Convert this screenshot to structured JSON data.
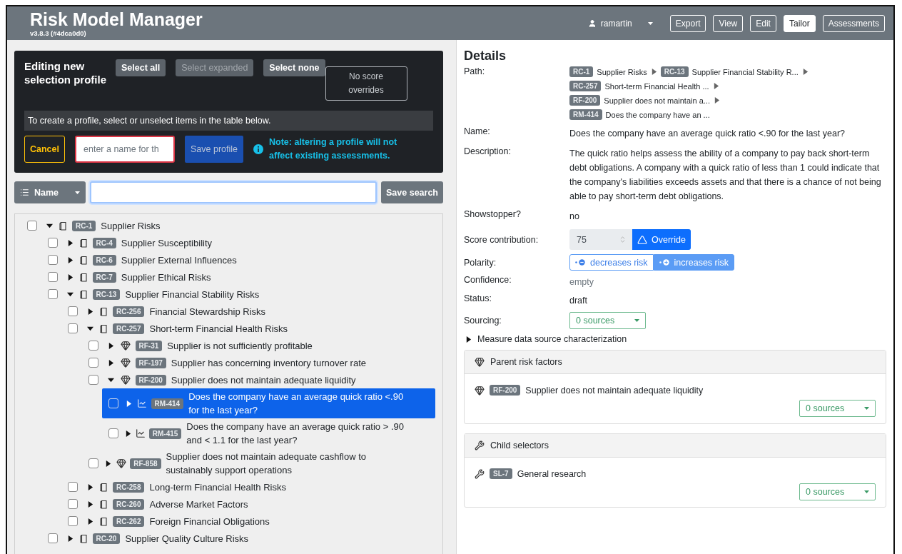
{
  "header": {
    "title": "Risk Model Manager",
    "version": "v3.8.3 (#4dca0d0)",
    "user": "ramartin",
    "nav": [
      {
        "label": "Export",
        "selected": false
      },
      {
        "label": "View",
        "selected": false
      },
      {
        "label": "Edit",
        "selected": false
      },
      {
        "label": "Tailor",
        "selected": true
      },
      {
        "label": "Assessments",
        "selected": false
      }
    ]
  },
  "profile_editor": {
    "title": "Editing new selection profile",
    "select_buttons": [
      {
        "label": "Select all",
        "disabled": false
      },
      {
        "label": "Select expanded",
        "disabled": true
      },
      {
        "label": "Select none",
        "disabled": false
      }
    ],
    "overrides_button": "No score overrides",
    "hint": "To create a profile, select or unselect items in the table below.",
    "cancel_button": "Cancel",
    "name_field": {
      "placeholder": "enter a name for th"
    },
    "save_button": "Save profile",
    "note": "Note: altering a profile will not affect existing assessments."
  },
  "search": {
    "field_button": "Name",
    "save_button": "Save search"
  },
  "tree": [
    {
      "kind": "category",
      "code": "RC-1",
      "label": "Supplier Risks",
      "checked": false,
      "expanded": true,
      "selected": false,
      "children": [
        {
          "kind": "category",
          "code": "RC-4",
          "label": "Supplier Susceptibility",
          "checked": false,
          "expanded": false,
          "selected": false
        },
        {
          "kind": "category",
          "code": "RC-6",
          "label": "Supplier External Influences",
          "checked": false,
          "expanded": false,
          "selected": false
        },
        {
          "kind": "category",
          "code": "RC-7",
          "label": "Supplier Ethical Risks",
          "checked": false,
          "expanded": false,
          "selected": false
        },
        {
          "kind": "category",
          "code": "RC-13",
          "label": "Supplier Financial Stability Risks",
          "checked": false,
          "expanded": true,
          "selected": false,
          "children": [
            {
              "kind": "category",
              "code": "RC-256",
              "label": "Financial Stewardship Risks",
              "checked": false,
              "expanded": false,
              "selected": false
            },
            {
              "kind": "category",
              "code": "RC-257",
              "label": "Short-term Financial Health Risks",
              "checked": false,
              "expanded": true,
              "selected": false,
              "children": [
                {
                  "kind": "factor",
                  "code": "RF-31",
                  "label": "Supplier is not sufficiently profitable",
                  "checked": false,
                  "expanded": false,
                  "selected": false
                },
                {
                  "kind": "factor",
                  "code": "RF-197",
                  "label": "Supplier has concerning inventory turnover rate",
                  "checked": false,
                  "expanded": false,
                  "selected": false
                },
                {
                  "kind": "factor",
                  "code": "RF-200",
                  "label": "Supplier does not maintain adequate liquidity",
                  "checked": false,
                  "expanded": true,
                  "selected": false,
                  "children": [
                    {
                      "kind": "measure",
                      "code": "RM-414",
                      "label": "Does the company have an average quick ratio <.90 for the last year?",
                      "checked": false,
                      "expanded": false,
                      "selected": true
                    },
                    {
                      "kind": "measure",
                      "code": "RM-415",
                      "label": "Does the company have an average quick ratio > .90 and < 1.1 for the last year?",
                      "checked": false,
                      "expanded": false,
                      "selected": false
                    }
                  ]
                },
                {
                  "kind": "factor",
                  "code": "RF-858",
                  "label": "Supplier does not maintain adequate cashflow to sustainably support operations",
                  "checked": false,
                  "expanded": false,
                  "selected": false
                }
              ]
            },
            {
              "kind": "category",
              "code": "RC-258",
              "label": "Long-term Financial Health Risks",
              "checked": false,
              "expanded": false,
              "selected": false
            },
            {
              "kind": "category",
              "code": "RC-260",
              "label": "Adverse Market Factors",
              "checked": false,
              "expanded": false,
              "selected": false
            },
            {
              "kind": "category",
              "code": "RC-262",
              "label": "Foreign Financial Obligations",
              "checked": false,
              "expanded": false,
              "selected": false
            }
          ]
        },
        {
          "kind": "category",
          "code": "RC-20",
          "label": "Supplier Quality Culture Risks",
          "checked": false,
          "expanded": false,
          "selected": false
        }
      ]
    }
  ],
  "details": {
    "title": "Details",
    "path": {
      "label": "Path:",
      "lines": [
        [
          {
            "code": "RC-1",
            "label": "Supplier Risks"
          },
          {
            "code": "RC-13",
            "label": "Supplier Financial Stability R..."
          }
        ],
        [
          {
            "code": "RC-257",
            "label": "Short-term Financial Health ..."
          }
        ],
        [
          {
            "code": "RF-200",
            "label": "Supplier does not maintain a..."
          }
        ],
        [
          {
            "code": "RM-414",
            "label": "Does the company have an ..."
          }
        ]
      ]
    },
    "name": {
      "label": "Name:",
      "value": "Does the company have an average quick ratio <.90 for the last year?"
    },
    "description": {
      "label": "Description:",
      "value": "The quick ratio helps assess the ability of a company to pay back short-term debt obligations. A company with a quick ratio of less than 1 could indicate that the company's liabilities exceeds assets and that there is a chance of not being able to pay short-term debt obligations."
    },
    "showstopper": {
      "label": "Showstopper?",
      "value": "no"
    },
    "score": {
      "label": "Score contribution:",
      "value": "75",
      "button": "Override"
    },
    "polarity": {
      "label": "Polarity:",
      "options": [
        {
          "label": "decreases risk",
          "selected": false
        },
        {
          "label": "increases risk",
          "selected": true
        }
      ]
    },
    "confidence": {
      "label": "Confidence:",
      "value": "empty",
      "muted": true
    },
    "status": {
      "label": "Status:",
      "value": "draft",
      "muted": false
    },
    "sourcing": {
      "label": "Sourcing:",
      "value": "0 sources"
    },
    "characterization": {
      "label": "Measure data source characterization",
      "expanded": false
    }
  },
  "sections": [
    {
      "kind": "factor",
      "title": "Parent risk factors",
      "items": [
        {
          "code": "RF-200",
          "label": "Supplier does not maintain adequate liquidity",
          "sources": "0 sources"
        }
      ]
    },
    {
      "kind": "selector",
      "title": "Child selectors",
      "items": [
        {
          "code": "SL-7",
          "label": "General research",
          "sources": "0 sources"
        }
      ]
    }
  ]
}
